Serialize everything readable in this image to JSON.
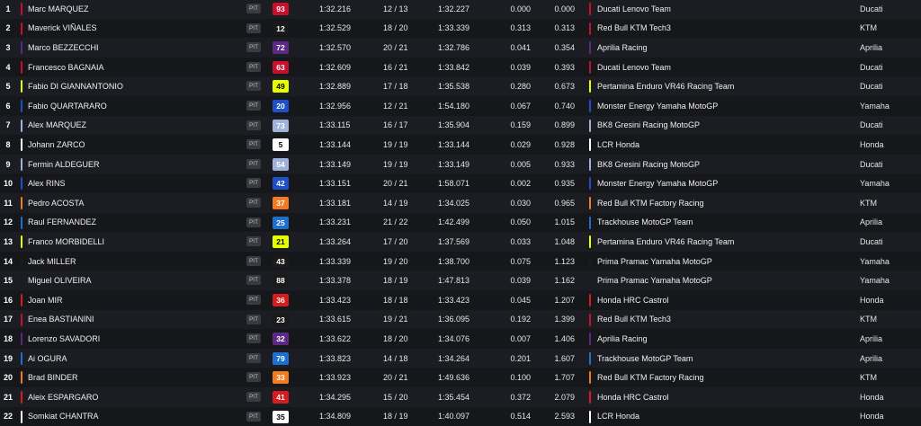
{
  "pit_label": "PIT",
  "rows": [
    {
      "pos": "1",
      "rider": "Marc MARQUEZ",
      "num": "93",
      "num_bg": "#c8102e",
      "num_fg": "#ffffff",
      "best": "1:32.216",
      "laps": "12 / 13",
      "last": "1:32.227",
      "gap": "0.000",
      "int": "0.000",
      "team": "Ducati Lenovo Team",
      "team_color": "#c8102e",
      "maker": "Ducati"
    },
    {
      "pos": "2",
      "rider": "Maverick VIÑALES",
      "num": "12",
      "num_bg": "#1a1a1a",
      "num_fg": "#ffffff",
      "best": "1:32.529",
      "laps": "18 / 20",
      "last": "1:33.339",
      "gap": "0.313",
      "int": "0.313",
      "team": "Red Bull KTM Tech3",
      "team_color": "#c8102e",
      "maker": "KTM"
    },
    {
      "pos": "3",
      "rider": "Marco BEZZECCHI",
      "num": "72",
      "num_bg": "#5b2a86",
      "num_fg": "#ffffff",
      "best": "1:32.570",
      "laps": "20 / 21",
      "last": "1:32.786",
      "gap": "0.041",
      "int": "0.354",
      "team": "Aprilia Racing",
      "team_color": "#5b2a86",
      "maker": "Aprilia"
    },
    {
      "pos": "4",
      "rider": "Francesco BAGNAIA",
      "num": "63",
      "num_bg": "#c8102e",
      "num_fg": "#ffffff",
      "best": "1:32.609",
      "laps": "16 / 21",
      "last": "1:33.842",
      "gap": "0.039",
      "int": "0.393",
      "team": "Ducati Lenovo Team",
      "team_color": "#c8102e",
      "maker": "Ducati"
    },
    {
      "pos": "5",
      "rider": "Fabio DI GIANNANTONIO",
      "num": "49",
      "num_bg": "#e6ff00",
      "num_fg": "#000000",
      "best": "1:32.889",
      "laps": "17 / 18",
      "last": "1:35.538",
      "gap": "0.280",
      "int": "0.673",
      "team": "Pertamina Enduro VR46 Racing Team",
      "team_color": "#e6ff00",
      "maker": "Ducati"
    },
    {
      "pos": "6",
      "rider": "Fabio QUARTARARO",
      "num": "20",
      "num_bg": "#1e50c8",
      "num_fg": "#ffffff",
      "best": "1:32.956",
      "laps": "12 / 21",
      "last": "1:54.180",
      "gap": "0.067",
      "int": "0.740",
      "team": "Monster Energy Yamaha MotoGP",
      "team_color": "#1e50c8",
      "maker": "Yamaha"
    },
    {
      "pos": "7",
      "rider": "Alex MARQUEZ",
      "num": "73",
      "num_bg": "#9fb3d9",
      "num_fg": "#ffffff",
      "best": "1:33.115",
      "laps": "16 / 17",
      "last": "1:35.904",
      "gap": "0.159",
      "int": "0.899",
      "team": "BK8 Gresini Racing MotoGP",
      "team_color": "#9fb3d9",
      "maker": "Ducati"
    },
    {
      "pos": "8",
      "rider": "Johann ZARCO",
      "num": "5",
      "num_bg": "#ffffff",
      "num_fg": "#000000",
      "best": "1:33.144",
      "laps": "19 / 19",
      "last": "1:33.144",
      "gap": "0.029",
      "int": "0.928",
      "team": "LCR Honda",
      "team_color": "#ffffff",
      "maker": "Honda"
    },
    {
      "pos": "9",
      "rider": "Fermin ALDEGUER",
      "num": "54",
      "num_bg": "#9fb3d9",
      "num_fg": "#ffffff",
      "best": "1:33.149",
      "laps": "19 / 19",
      "last": "1:33.149",
      "gap": "0.005",
      "int": "0.933",
      "team": "BK8 Gresini Racing MotoGP",
      "team_color": "#9fb3d9",
      "maker": "Ducati"
    },
    {
      "pos": "10",
      "rider": "Alex RINS",
      "num": "42",
      "num_bg": "#1e50c8",
      "num_fg": "#ffffff",
      "best": "1:33.151",
      "laps": "20 / 21",
      "last": "1:58.071",
      "gap": "0.002",
      "int": "0.935",
      "team": "Monster Energy Yamaha MotoGP",
      "team_color": "#1e50c8",
      "maker": "Yamaha"
    },
    {
      "pos": "11",
      "rider": "Pedro ACOSTA",
      "num": "37",
      "num_bg": "#f47a20",
      "num_fg": "#ffffff",
      "best": "1:33.181",
      "laps": "14 / 19",
      "last": "1:34.025",
      "gap": "0.030",
      "int": "0.965",
      "team": "Red Bull KTM Factory Racing",
      "team_color": "#f47a20",
      "maker": "KTM"
    },
    {
      "pos": "12",
      "rider": "Raul FERNANDEZ",
      "num": "25",
      "num_bg": "#1f6fd1",
      "num_fg": "#ffffff",
      "best": "1:33.231",
      "laps": "21 / 22",
      "last": "1:42.499",
      "gap": "0.050",
      "int": "1.015",
      "team": "Trackhouse MotoGP Team",
      "team_color": "#1f6fd1",
      "maker": "Aprilia"
    },
    {
      "pos": "13",
      "rider": "Franco MORBIDELLI",
      "num": "21",
      "num_bg": "#e6ff00",
      "num_fg": "#000000",
      "best": "1:33.264",
      "laps": "17 / 20",
      "last": "1:37.569",
      "gap": "0.033",
      "int": "1.048",
      "team": "Pertamina Enduro VR46 Racing Team",
      "team_color": "#e6ff00",
      "maker": "Ducati"
    },
    {
      "pos": "14",
      "rider": "Jack MILLER",
      "num": "43",
      "num_bg": "#1a1a1a",
      "num_fg": "#ffffff",
      "best": "1:33.339",
      "laps": "19 / 20",
      "last": "1:38.700",
      "gap": "0.075",
      "int": "1.123",
      "team": "Prima Pramac Yamaha MotoGP",
      "team_color": "#1a1a1a",
      "maker": "Yamaha"
    },
    {
      "pos": "15",
      "rider": "Miguel OLIVEIRA",
      "num": "88",
      "num_bg": "#1a1a1a",
      "num_fg": "#ffffff",
      "best": "1:33.378",
      "laps": "18 / 19",
      "last": "1:47.813",
      "gap": "0.039",
      "int": "1.162",
      "team": "Prima Pramac Yamaha MotoGP",
      "team_color": "#1a1a1a",
      "maker": "Yamaha"
    },
    {
      "pos": "16",
      "rider": "Joan MIR",
      "num": "36",
      "num_bg": "#d61c1c",
      "num_fg": "#ffffff",
      "best": "1:33.423",
      "laps": "18 / 18",
      "last": "1:33.423",
      "gap": "0.045",
      "int": "1.207",
      "team": "Honda HRC Castrol",
      "team_color": "#d61c1c",
      "maker": "Honda"
    },
    {
      "pos": "17",
      "rider": "Enea BASTIANINI",
      "num": "23",
      "num_bg": "#1a1a1a",
      "num_fg": "#ffffff",
      "best": "1:33.615",
      "laps": "19 / 21",
      "last": "1:36.095",
      "gap": "0.192",
      "int": "1.399",
      "team": "Red Bull KTM Tech3",
      "team_color": "#c8102e",
      "maker": "KTM"
    },
    {
      "pos": "18",
      "rider": "Lorenzo SAVADORI",
      "num": "32",
      "num_bg": "#5b2a86",
      "num_fg": "#ffffff",
      "best": "1:33.622",
      "laps": "18 / 20",
      "last": "1:34.076",
      "gap": "0.007",
      "int": "1.406",
      "team": "Aprilia Racing",
      "team_color": "#5b2a86",
      "maker": "Aprilia"
    },
    {
      "pos": "19",
      "rider": "Ai OGURA",
      "num": "79",
      "num_bg": "#1f6fd1",
      "num_fg": "#ffffff",
      "best": "1:33.823",
      "laps": "14 / 18",
      "last": "1:34.264",
      "gap": "0.201",
      "int": "1.607",
      "team": "Trackhouse MotoGP Team",
      "team_color": "#1f6fd1",
      "maker": "Aprilia"
    },
    {
      "pos": "20",
      "rider": "Brad BINDER",
      "num": "33",
      "num_bg": "#f47a20",
      "num_fg": "#ffffff",
      "best": "1:33.923",
      "laps": "20 / 21",
      "last": "1:49.636",
      "gap": "0.100",
      "int": "1.707",
      "team": "Red Bull KTM Factory Racing",
      "team_color": "#f47a20",
      "maker": "KTM"
    },
    {
      "pos": "21",
      "rider": "Aleix ESPARGARO",
      "num": "41",
      "num_bg": "#d61c1c",
      "num_fg": "#ffffff",
      "best": "1:34.295",
      "laps": "15 / 20",
      "last": "1:35.454",
      "gap": "0.372",
      "int": "2.079",
      "team": "Honda HRC Castrol",
      "team_color": "#d61c1c",
      "maker": "Honda"
    },
    {
      "pos": "22",
      "rider": "Somkiat CHANTRA",
      "num": "35",
      "num_bg": "#ffffff",
      "num_fg": "#000000",
      "best": "1:34.809",
      "laps": "18 / 19",
      "last": "1:40.097",
      "gap": "0.514",
      "int": "2.593",
      "team": "LCR Honda",
      "team_color": "#ffffff",
      "maker": "Honda"
    }
  ]
}
